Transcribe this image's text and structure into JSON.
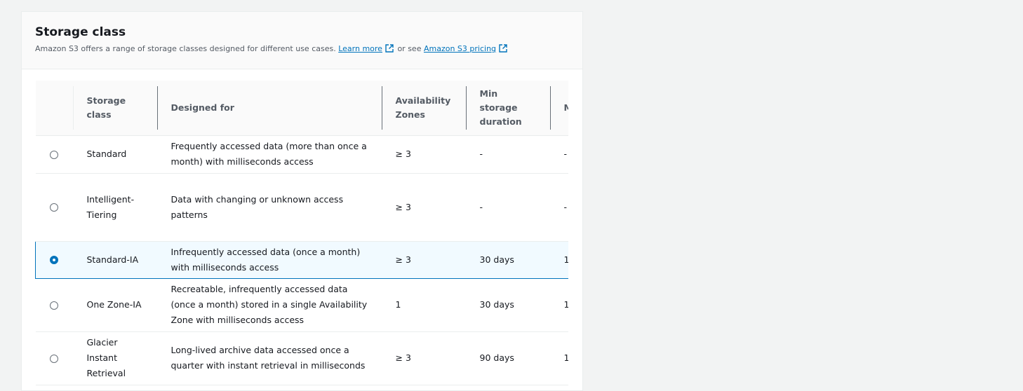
{
  "panel": {
    "title": "Storage class",
    "description": "Amazon S3 offers a range of storage classes designed for different use cases.",
    "learn_more": "Learn more",
    "or_see": "or see",
    "pricing_link": "Amazon S3 pricing"
  },
  "table": {
    "headers": {
      "storage_class": "Storage class",
      "designed_for": "Designed for",
      "availability_zones": "Availability Zones",
      "min_storage_duration": "Min storage duration",
      "next_partial": "M o"
    },
    "rows": [
      {
        "storage_class": "Standard",
        "designed_for": "Frequently accessed data (more than once a month) with milliseconds access",
        "availability_zones": "≥ 3",
        "min_storage_duration": "-",
        "next_partial": "-",
        "selected": false
      },
      {
        "storage_class": "Intelligent-Tiering",
        "designed_for": "Data with changing or unknown access patterns",
        "availability_zones": "≥ 3",
        "min_storage_duration": "-",
        "next_partial": "-",
        "selected": false
      },
      {
        "storage_class": "Standard-IA",
        "designed_for": "Infrequently accessed data (once a month) with milliseconds access",
        "availability_zones": "≥ 3",
        "min_storage_duration": "30 days",
        "next_partial": "1",
        "selected": true
      },
      {
        "storage_class": "One Zone-IA",
        "designed_for": "Recreatable, infrequently accessed data (once a month) stored in a single Availability Zone with milliseconds access",
        "availability_zones": "1",
        "min_storage_duration": "30 days",
        "next_partial": "1",
        "selected": false
      },
      {
        "storage_class": "Glacier Instant Retrieval",
        "designed_for": "Long-lived archive data accessed once a quarter with instant retrieval in milliseconds",
        "availability_zones": "≥ 3",
        "min_storage_duration": "90 days",
        "next_partial": "1",
        "selected": false
      }
    ]
  },
  "colors": {
    "accent": "#0073bb",
    "selected_bg": "#f1faff",
    "page_bg": "#f2f3f3"
  }
}
